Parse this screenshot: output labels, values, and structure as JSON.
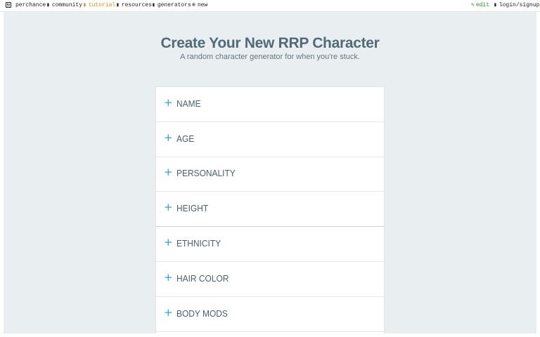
{
  "topbar": {
    "brand": "perchance",
    "community": "community",
    "tutorial": "tutorial",
    "resources": "resources",
    "generators": "generators",
    "new": "new",
    "edit": "edit",
    "login": "login/signup",
    "community_icon": "chat-icon",
    "tutorial_icon": "book-icon",
    "resources_icon": "wrench-icon",
    "generators_icon": "list-icon",
    "new_icon": "plus-circle-icon",
    "edit_icon": "pencil-icon",
    "login_icon": "user-icon"
  },
  "header": {
    "title": "Create Your New RRP Character",
    "subtitle": "A random character generator for when you're stuck."
  },
  "sections": [
    {
      "label": "NAME"
    },
    {
      "label": "AGE"
    },
    {
      "label": "PERSONALITY"
    },
    {
      "label": "HEIGHT"
    },
    {
      "label": "ETHNICITY"
    },
    {
      "label": "HAIR COLOR"
    },
    {
      "label": "BODY MODS"
    }
  ],
  "colors": {
    "accent": "#26a9c8",
    "title": "#4f6b78",
    "background": "#e9eef1",
    "tutorial": "#e08a16",
    "edit": "#2e8a2e"
  }
}
